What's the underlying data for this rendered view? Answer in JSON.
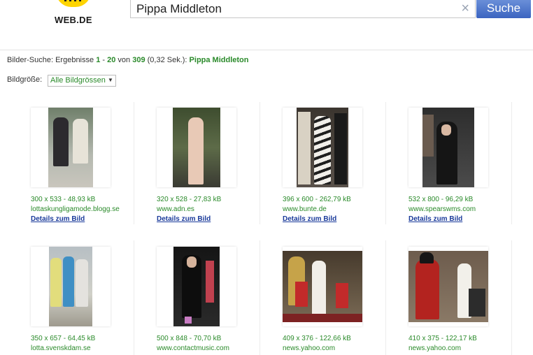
{
  "header": {
    "logo_text": "WEB.DE",
    "search_value": "Pippa Middleton",
    "search_button": "Suche",
    "clear_icon": "×"
  },
  "results": {
    "prefix": "Bilder-Suche: Ergebnisse ",
    "from": "1",
    "dash": " - ",
    "to": "20",
    "of_word": " von ",
    "total": "309",
    "time": " (0,32 Sek.): ",
    "query": "Pippa Middleton"
  },
  "size_filter": {
    "label": "Bildgröße:",
    "selected": "Alle Bildgrössen"
  },
  "images": [
    {
      "dims": "300 x 533 - 48,93 kB",
      "source": "lottaskungligamode.blogg.se",
      "details": "Details zum Bild"
    },
    {
      "dims": "320 x 528 - 27,83 kB",
      "source": "www.adn.es",
      "details": "Details zum Bild"
    },
    {
      "dims": "396 x 600 - 262,79 kB",
      "source": "www.bunte.de",
      "details": "Details zum Bild"
    },
    {
      "dims": "532 x 800 - 96,29 kB",
      "source": "www.spearswms.com",
      "details": "Details zum Bild"
    },
    {
      "dims": "350 x 657 - 64,45 kB",
      "source": "lotta.svenskdam.se",
      "details": ""
    },
    {
      "dims": "500 x 848 - 70,70 kB",
      "source": "www.contactmusic.com",
      "details": ""
    },
    {
      "dims": "409 x 376 - 122,66 kB",
      "source": "news.yahoo.com",
      "details": ""
    },
    {
      "dims": "410 x 375 - 122,17 kB",
      "source": "news.yahoo.com",
      "details": ""
    }
  ],
  "colors": {
    "accent_green": "#2a8a2a",
    "link_blue": "#1a3a9a",
    "button_blue": "#3b64c0",
    "logo_yellow": "#ffd400"
  }
}
